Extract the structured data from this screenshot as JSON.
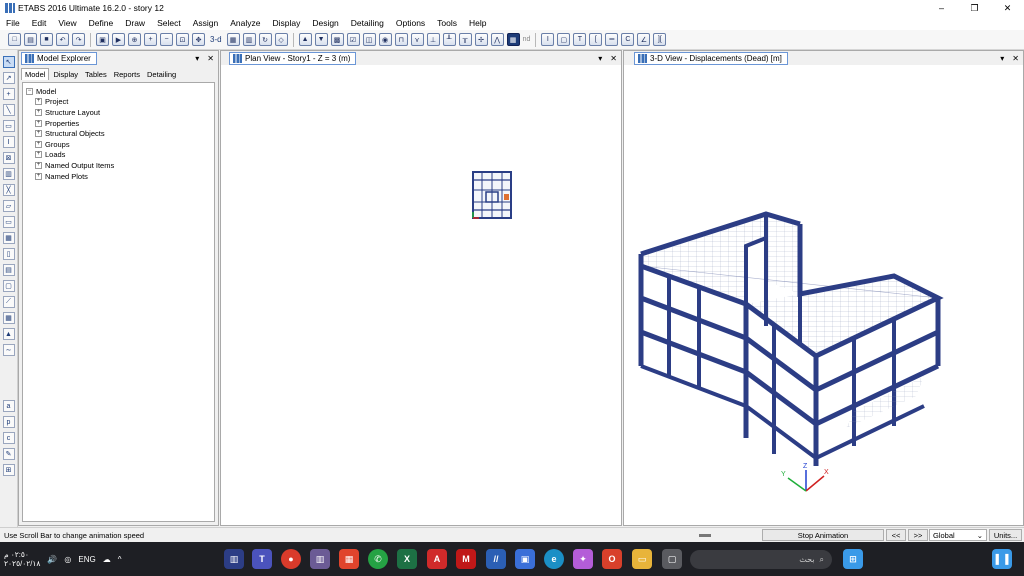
{
  "window": {
    "title": "ETABS 2016 Ultimate 16.2.0 - story 12",
    "buttons": [
      "–",
      "❐",
      "✕"
    ]
  },
  "menu": [
    "File",
    "Edit",
    "View",
    "Define",
    "Draw",
    "Select",
    "Assign",
    "Analyze",
    "Display",
    "Design",
    "Detailing",
    "Options",
    "Tools",
    "Help"
  ],
  "toolbar": {
    "label_3d": "3-d",
    "label_nd": "nd"
  },
  "explorer": {
    "title": "Model Explorer",
    "tabs": [
      "Model",
      "Display",
      "Tables",
      "Reports",
      "Detailing"
    ],
    "active_tab": "Model",
    "root": "Model",
    "items": [
      "Project",
      "Structure Layout",
      "Properties",
      "Structural Objects",
      "Groups",
      "Loads",
      "Named Output Items",
      "Named Plots"
    ]
  },
  "plan_view": {
    "title": "Plan View - Story1 - Z = 3 (m)"
  },
  "view_3d": {
    "title": "3-D View  - Displacements (Dead)  [m]",
    "axes": {
      "x": "X",
      "y": "Y",
      "z": "Z"
    }
  },
  "panel_controls": {
    "dropdown": "▾",
    "close": "✕"
  },
  "status": {
    "message": "Use Scroll Bar to change animation speed",
    "stop_animation": "Stop Animation",
    "prev": "<<",
    "next": ">>",
    "coord_system": "Global",
    "units": "Units..."
  },
  "taskbar": {
    "time": "٠٢:٥٠ م",
    "date": "٢٠٢٥/٠٢/١٨",
    "lang": "ENG",
    "search_placeholder": "بحث"
  }
}
